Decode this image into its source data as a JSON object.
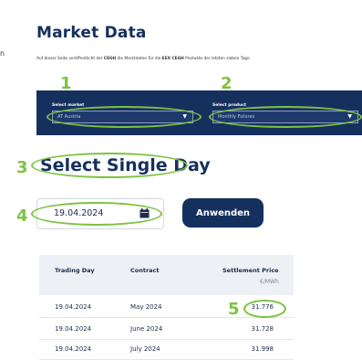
{
  "stray_text": "n",
  "page": {
    "title": "Market Data",
    "description_parts": [
      "Auf dieser Seite veröffentlicht der ",
      "CEGH",
      " die Marktdaten für die ",
      "EEX CEGH",
      " Produkte der letzten sieben Tage."
    ]
  },
  "markers": [
    "1",
    "2",
    "3",
    "4",
    "5"
  ],
  "filters": {
    "market_label": "Select market",
    "market_value": "AT Austria",
    "product_label": "Select product",
    "product_value": "Monthly Futures"
  },
  "section": {
    "subtitle": "Select Single Day"
  },
  "date_input": {
    "value": "19.04.2024"
  },
  "apply_button": {
    "label": "Anwenden"
  },
  "table": {
    "headers": {
      "trading_day": "Trading Day",
      "contract": "Contract",
      "settlement": "Settlement Price",
      "unit": "€/MWh"
    },
    "rows": [
      {
        "day": "19.04.2024",
        "contract": "May 2024",
        "price": "31.776"
      },
      {
        "day": "19.04.2024",
        "contract": "June 2024",
        "price": "31.728"
      },
      {
        "day": "19.04.2024",
        "contract": "July 2024",
        "price": "31.998"
      }
    ]
  },
  "colors": {
    "navy": "#16305e",
    "highlight_green": "#7dc242"
  },
  "icons": [
    "chevron-down-icon",
    "calendar-icon"
  ]
}
